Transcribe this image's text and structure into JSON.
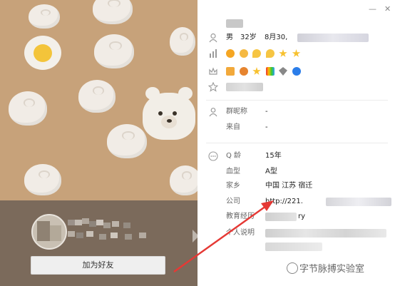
{
  "profile_card": {
    "add_friend_label": "加为好友",
    "basic": {
      "gender": "男",
      "age": "32岁",
      "birthday": "8月30,"
    },
    "group_nickname": {
      "label": "群昵称",
      "value": "-"
    },
    "source": {
      "label": "来自",
      "value": "-"
    },
    "q_age": {
      "label": "Q 龄",
      "value": "15年"
    },
    "blood_type": {
      "label": "血型",
      "value": "A型"
    },
    "hometown": {
      "label": "家乡",
      "value": "中国 江苏 宿迁"
    },
    "company": {
      "label": "公司",
      "value": "http://221."
    },
    "education": {
      "label": "教育经历",
      "value": "ry"
    },
    "personal_note": {
      "label": "个人说明",
      "value": ""
    }
  },
  "watermark": {
    "text": "字节脉搏实验室"
  },
  "colors": {
    "left_bg": "#c7a27a",
    "left_bottom_bg": "#7b6a5b",
    "arrow_red": "#e53935"
  }
}
